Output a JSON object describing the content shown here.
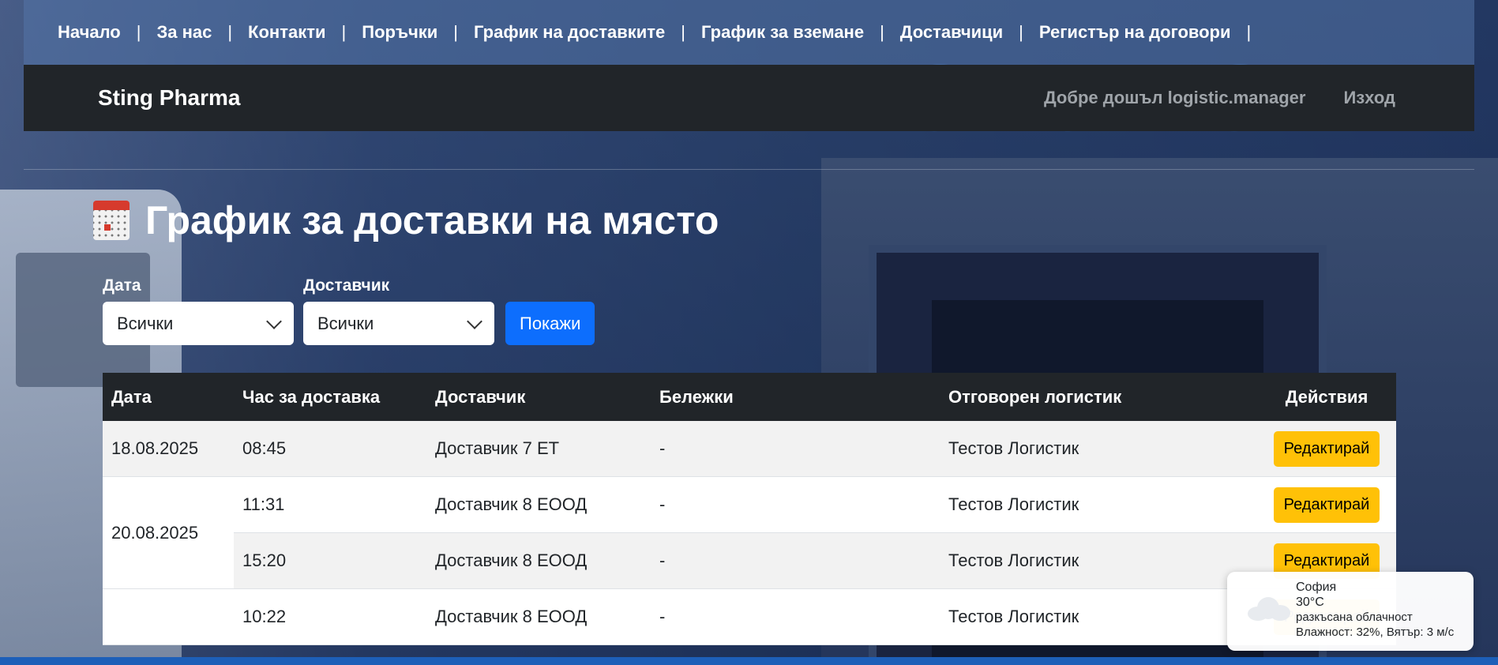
{
  "nav": {
    "items": [
      "Начало",
      "За нас",
      "Контакти",
      "Поръчки",
      "График на доставките",
      "График за вземане",
      "Доставчици",
      "Регистър на договори"
    ],
    "separator": "|"
  },
  "header": {
    "brand": "Sting Pharma",
    "welcome": "Добре дошъл logistic.manager",
    "logout": "Изход"
  },
  "page": {
    "title": "График за доставки на място",
    "title_icon": "calendar-icon"
  },
  "filters": {
    "date_label": "Дата",
    "date_value": "Всички",
    "supplier_label": "Доставчик",
    "supplier_value": "Всички",
    "show_button": "Покажи"
  },
  "table": {
    "columns": [
      "Дата",
      "Час за доставка",
      "Доставчик",
      "Бележки",
      "Отговорен логистик",
      "Действия"
    ],
    "edit_label": "Редактирай",
    "rows": [
      {
        "date": "18.08.2025",
        "time": "08:45",
        "supplier": "Доставчик 7 ЕТ",
        "notes": "-",
        "logistic": "Тестов Логистик"
      },
      {
        "date": "20.08.2025",
        "time": "11:31",
        "supplier": "Доставчик 8 ЕООД",
        "notes": "-",
        "logistic": "Тестов Логистик"
      },
      {
        "date": "",
        "time": "15:20",
        "supplier": "Доставчик 8 ЕООД",
        "notes": "-",
        "logistic": "Тестов Логистик"
      },
      {
        "date": "",
        "time": "10:22",
        "supplier": "Доставчик 8 ЕООД",
        "notes": "-",
        "logistic": "Тестов Логистик"
      }
    ]
  },
  "weather": {
    "city": "София",
    "temp": "30°C",
    "desc": "разкъсана облачност",
    "details": "Влажност: 32%, Вятър: 3 м/с",
    "icon": "cloud-icon"
  },
  "colors": {
    "header_bg": "#212529",
    "primary": "#0d6efd",
    "warning": "#ffc107"
  }
}
